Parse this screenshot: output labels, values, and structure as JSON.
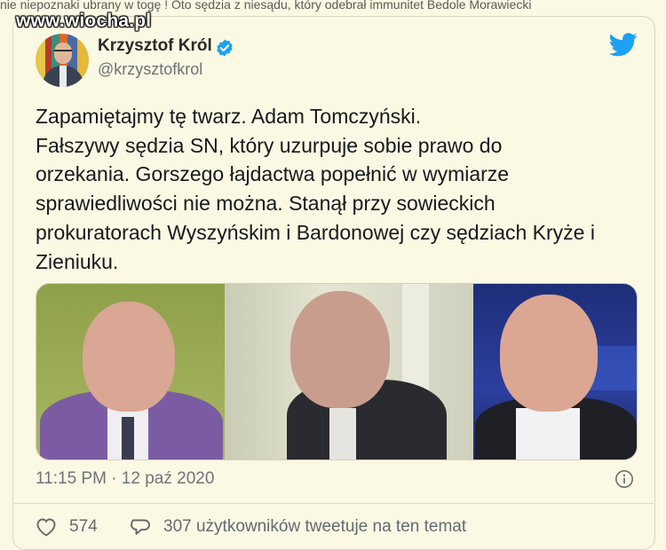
{
  "top_strip": {
    "text": "nie niepoznaki ubrany w togę ! Oto sędzia z niesądu, który odebrał immunitet Bedole Morawiecki"
  },
  "watermark": {
    "text": "www.wiocha.pl"
  },
  "tweet": {
    "author_name": "Krzysztof Król",
    "handle": "@krzysztofkrol",
    "verified_icon": "verified-badge-icon",
    "platform_icon": "twitter-bird-icon",
    "text": "Zapamiętajmy tę twarz. Adam Tomczyński.\nFałszywy sędzia SN, który uzurpuje sobie prawo do\norzekania. Gorszego łajdactwa popełnić w wymiarze\nsprawiedliwości nie można. Stanął przy sowieckich\nprokuratorach Wyszyńskim i Bardonowej czy sędziach Kryże i\nZieniuku.",
    "timestamp": "11:15 PM · 12 paź 2020",
    "info_icon": "info-icon",
    "likes": "574",
    "talking_about": "307 użytkowników tweetuje na ten temat"
  },
  "colors": {
    "background": "#fbf8e4",
    "twitter_blue": "#1da1f2",
    "muted_text": "#6e7276"
  }
}
